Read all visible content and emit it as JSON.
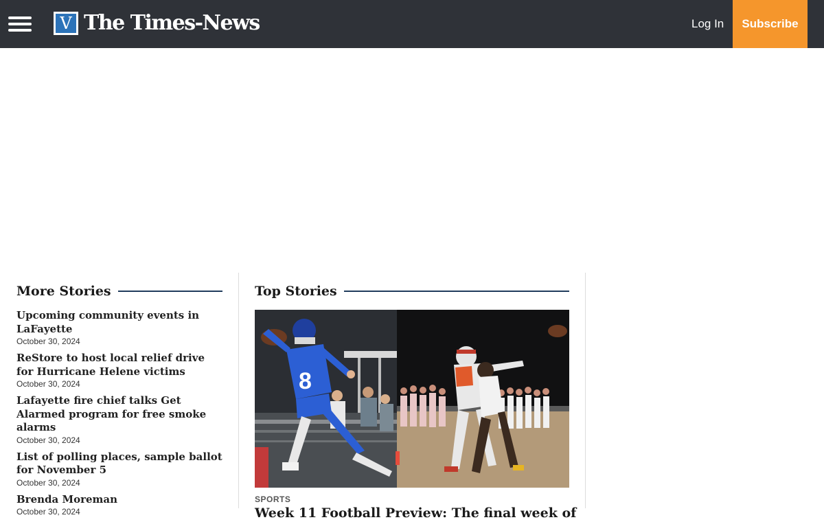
{
  "header": {
    "brand_letter": "V",
    "brand_name": "The Times-News",
    "login_label": "Log In",
    "subscribe_label": "Subscribe",
    "colors": {
      "bar": "#2f3238",
      "subscribe": "#f5962c",
      "brand_mark": "#2c73b9"
    }
  },
  "more_stories": {
    "heading": "More Stories",
    "items": [
      {
        "title": "Upcoming community events in LaFayette",
        "date": "October 30, 2024"
      },
      {
        "title": "ReStore to host local relief drive for Hurricane Helene victims",
        "date": "October 30, 2024"
      },
      {
        "title": "Lafayette fire chief talks Get Alarmed program for free smoke alarms",
        "date": "October 30, 2024"
      },
      {
        "title": "List of polling places, sample ballot for November 5",
        "date": "October 30, 2024"
      },
      {
        "title": "Brenda Moreman",
        "date": "October 30, 2024"
      }
    ]
  },
  "top_stories": {
    "heading": "Top Stories",
    "lead": {
      "category": "SPORTS",
      "headline": "Week 11 Football Preview: The final week of"
    }
  }
}
